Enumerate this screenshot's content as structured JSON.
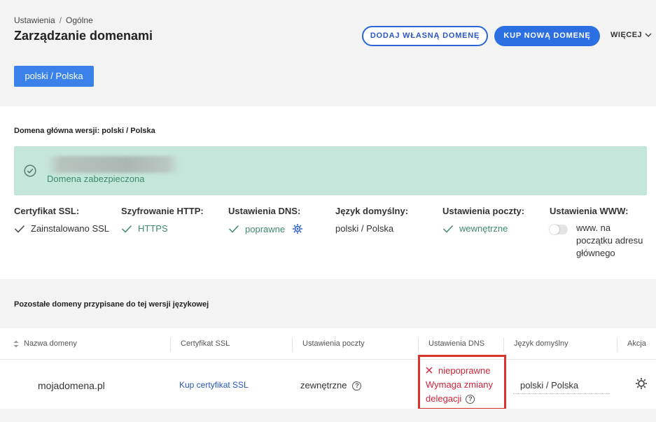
{
  "breadcrumb": {
    "parent": "Ustawienia",
    "separator": "/",
    "current": "Ogólne"
  },
  "page_title": "Zarządzanie domenami",
  "header_actions": {
    "add_own_domain": "DODAJ WŁASNĄ DOMENĘ",
    "buy_new_domain": "KUP NOWĄ DOMENĘ",
    "more": "WIĘCEJ"
  },
  "language_version_button": "polski / Polska",
  "main_domain": {
    "heading": "Domena główna wersji: polski / Polska",
    "status_text": "Domena zabezpieczona",
    "columns": [
      {
        "label": "Certyfikat SSL:",
        "value": "Zainstalowano SSL"
      },
      {
        "label": "Szyfrowanie HTTP:",
        "value": "HTTPS"
      },
      {
        "label": "Ustawienia DNS:",
        "value": "poprawne"
      },
      {
        "label": "Język domyślny:",
        "value": "polski / Polska"
      },
      {
        "label": "Ustawienia poczty:",
        "value": "wewnętrzne"
      },
      {
        "label": "Ustawienia WWW:",
        "value": "www. na początku adresu głównego"
      }
    ],
    "colors": {
      "box_bg": "#c5e6da",
      "ok_green": "#3e8a6a"
    }
  },
  "other_domains": {
    "heading": "Pozostałe domeny przypisane do tej wersji językowej",
    "columns": [
      "Nazwa domeny",
      "Certyfikat SSL",
      "Ustawienia poczty",
      "Ustawienia DNS",
      "Język domyślny",
      "Akcja"
    ],
    "rows": [
      {
        "domain": "mojadomena.pl",
        "ssl": "Kup certyfikat SSL",
        "mail": "zewnętrzne",
        "dns_status": "niepoprawne",
        "dns_line2": "Wymaga zmiany",
        "dns_line3": "delegacji",
        "language": "polski / Polska"
      }
    ]
  },
  "icons": {
    "check": "check-icon",
    "check_circle": "check-circle-icon",
    "gear": "gear-icon",
    "help": "question-circle-icon",
    "close": "x-icon",
    "sort": "sort-icon",
    "chevron": "chevron-down-icon"
  },
  "help_glyph": "?",
  "colors": {
    "primary": "#2b6fe3",
    "error": "#d0243a",
    "highlight_border": "#d9342b"
  }
}
